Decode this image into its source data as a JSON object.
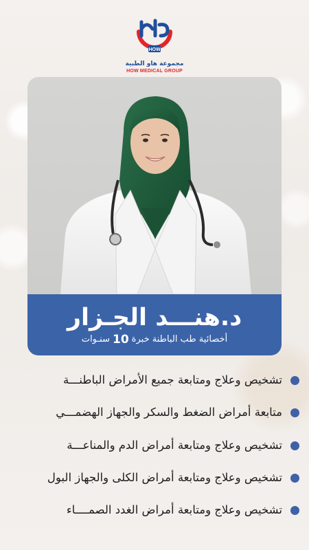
{
  "logo": {
    "mark_text": "هاو",
    "badge": "HOW",
    "name_ar": "مجموعة هاو الطبية",
    "name_en": "HOW MEDICAL GROUP"
  },
  "doctor": {
    "name": "د.هنـــد الجـزار",
    "subtitle_prefix": "أخصائية طب الباطنة خبرة",
    "years": "10",
    "subtitle_suffix": "سنـوات"
  },
  "services": [
    "تشخيص وعلاج ومتابعة جميع الأمراض الباطنـــة",
    "متابعة أمراض الضغط والسكر والجهاز الهضمـــي",
    "تشخيص وعلاج ومتابعة أمراض الدم والمناعـــة",
    "تشخيص وعلاج ومتابعة أمراض الكلى والجهاز البول",
    "تشخيص وعلاج ومتابعة أمراض الغدد الصمــــاء"
  ],
  "colors": {
    "brand_blue": "#3b63a8",
    "brand_red": "#e1262a",
    "bullet": "#3f61a7",
    "scrubs_green": "#1f5a3a"
  }
}
